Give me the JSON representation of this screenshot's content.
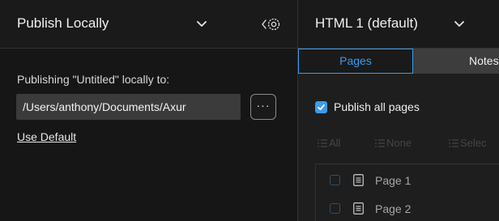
{
  "left_panel": {
    "title": "Publish Locally",
    "publishing_label": "Publishing \"Untitled\" locally to:",
    "path_value": "/Users/anthony/Documents/Axur",
    "more_button_label": "···",
    "use_default_label": "Use Default"
  },
  "right_panel": {
    "title": "HTML 1 (default)",
    "tabs": [
      {
        "label": "Pages",
        "active": true
      },
      {
        "label": "Notes",
        "active": false
      }
    ],
    "publish_all_label": "Publish all pages",
    "publish_all_checked": true,
    "select_actions": [
      {
        "label": "All"
      },
      {
        "label": "None"
      },
      {
        "label": "Selec"
      }
    ],
    "pages": [
      {
        "label": "Page 1",
        "checked": false
      },
      {
        "label": "Page 2",
        "checked": false
      }
    ]
  },
  "colors": {
    "accent": "#3d9be9",
    "background": "#161616",
    "panel": "#1e1e1e",
    "input": "#3b3b3b"
  }
}
